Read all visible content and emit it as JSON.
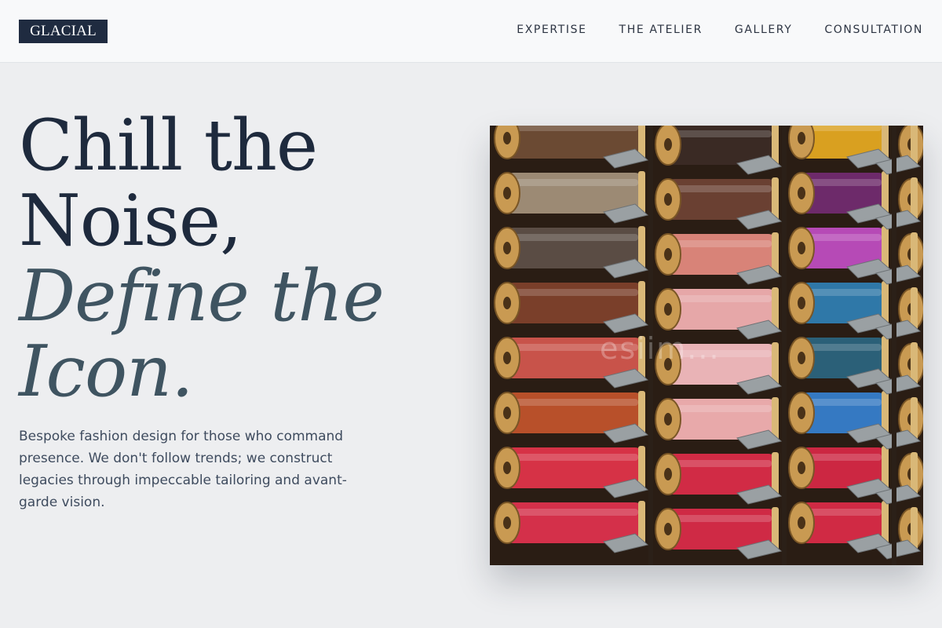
{
  "header": {
    "logo": "GLACIAL",
    "nav": [
      {
        "label": "EXPERTISE"
      },
      {
        "label": "THE ATELIER"
      },
      {
        "label": "GALLERY"
      },
      {
        "label": "CONSULTATION"
      }
    ]
  },
  "hero": {
    "title_line1": "Chill the",
    "title_line2": "Noise,",
    "title_line3": "Define the",
    "title_line4": "Icon.",
    "description": "Bespoke fashion design for those who command presence. We don't follow trends; we construct legacies through impeccable tailoring and avant-garde vision.",
    "image": {
      "subject": "rows of colorful thread spools on a rack",
      "watermark": "esiim..."
    }
  },
  "colors": {
    "background": "#edeef0",
    "header_bg": "#f8f9fa",
    "logo_bg": "#1f2b40",
    "heading": "#1e2a3d",
    "heading_italic": "#3f5461",
    "body_text": "#3e4b5e"
  }
}
